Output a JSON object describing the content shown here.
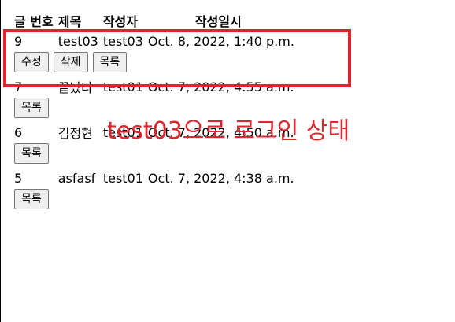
{
  "headers": {
    "no": "글 번호",
    "title": "제목",
    "author": "작성자",
    "date": "작성일시"
  },
  "rows": [
    {
      "no": "9",
      "title": "test03",
      "author": "test03",
      "date": "Oct. 8, 2022, 1:40 p.m.",
      "buttons": [
        "수정",
        "삭제",
        "목록"
      ]
    },
    {
      "no": "7",
      "title": "끝났다",
      "author": "test01",
      "date": "Oct. 7, 2022, 4:55 a.m.",
      "buttons": [
        "목록"
      ]
    },
    {
      "no": "6",
      "title": "김정현",
      "author": "test01",
      "date": "Oct. 7, 2022, 4:50 a.m.",
      "buttons": [
        "목록"
      ]
    },
    {
      "no": "5",
      "title": "asfasf",
      "author": "test01",
      "date": "Oct. 7, 2022, 4:38 a.m.",
      "buttons": [
        "목록"
      ]
    }
  ],
  "annotation": {
    "text": "test03으로 로그인 상태",
    "color": "#e0242b"
  }
}
